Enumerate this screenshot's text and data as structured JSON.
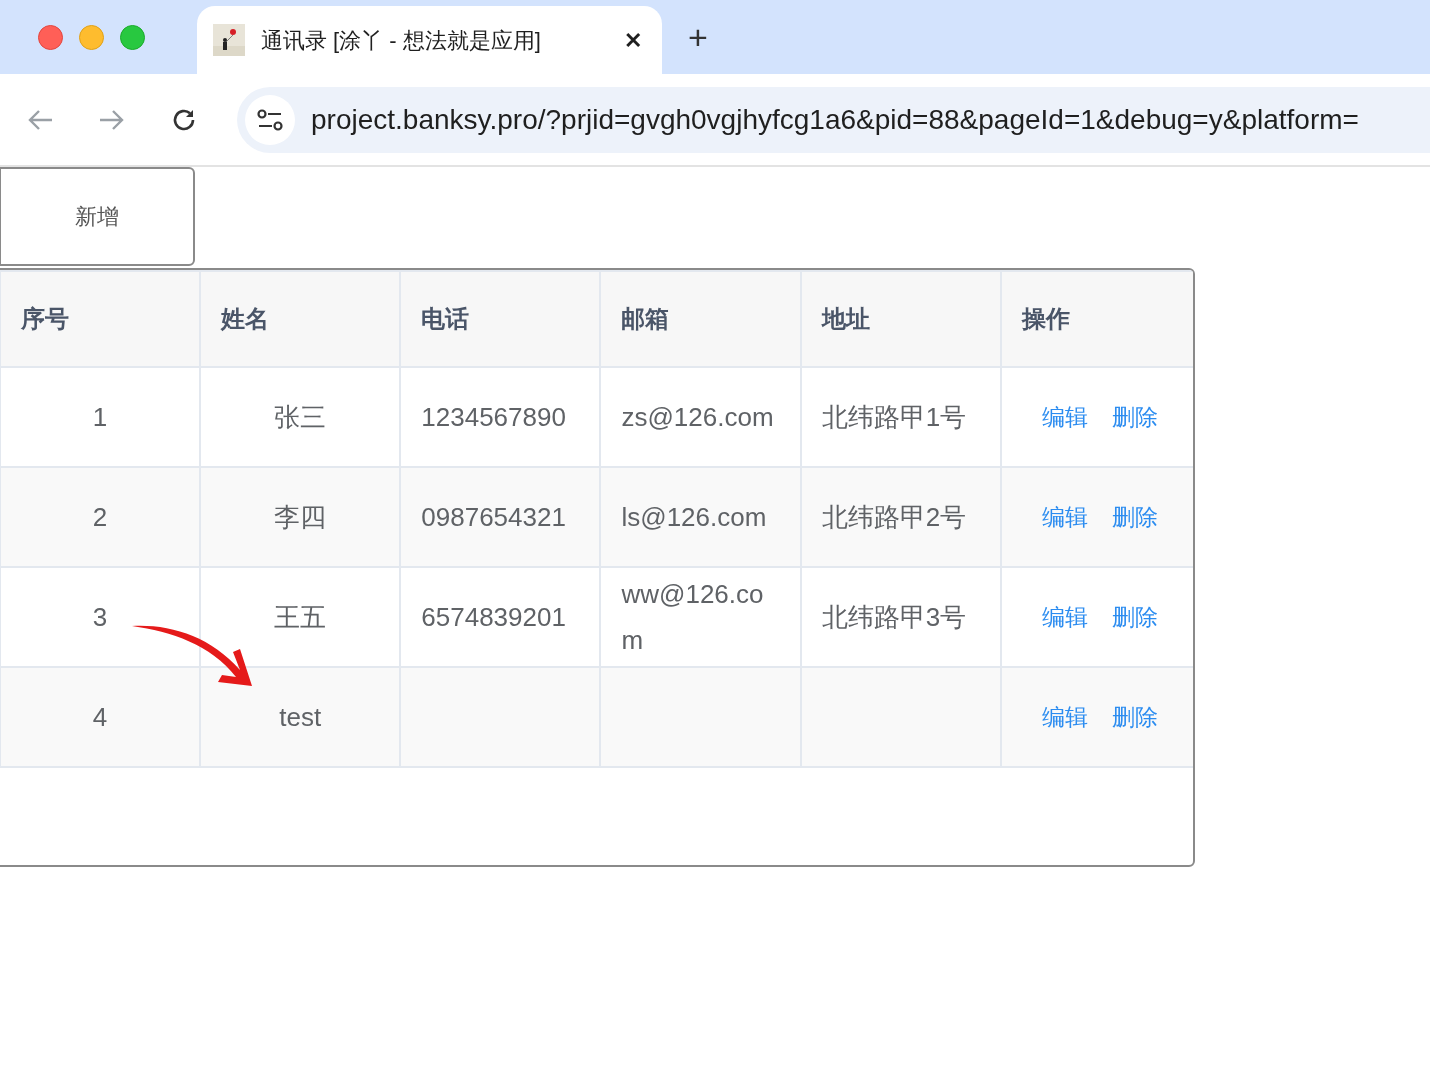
{
  "browser": {
    "tab_title": "通讯录 [涂丫 - 想法就是应用]",
    "close": "✕",
    "new_tab": "+",
    "url": "project.banksy.pro/?prjid=gvgh0vgjhyfcg1a6&pid=88&pageId=1&debug=y&platform="
  },
  "toolbar": {
    "add_button": "新增"
  },
  "table": {
    "columns": [
      "序号",
      "姓名",
      "电话",
      "邮箱",
      "地址",
      "操作"
    ],
    "rows": [
      {
        "cells": [
          "1",
          "张三",
          "1234567890",
          "zs@126.com",
          "北纬路甲1号"
        ],
        "actions": [
          "编辑",
          "删除"
        ]
      },
      {
        "cells": [
          "2",
          "李四",
          "0987654321",
          "ls@126.com",
          "北纬路甲2号"
        ],
        "actions": [
          "编辑",
          "删除"
        ]
      },
      {
        "cells": [
          "3",
          "王五",
          "6574839201",
          "ww@126.com",
          "北纬路甲3号"
        ],
        "actions": [
          "编辑",
          "删除"
        ]
      },
      {
        "cells": [
          "4",
          "test",
          "",
          "",
          ""
        ],
        "actions": [
          "编辑",
          "删除"
        ]
      }
    ]
  }
}
